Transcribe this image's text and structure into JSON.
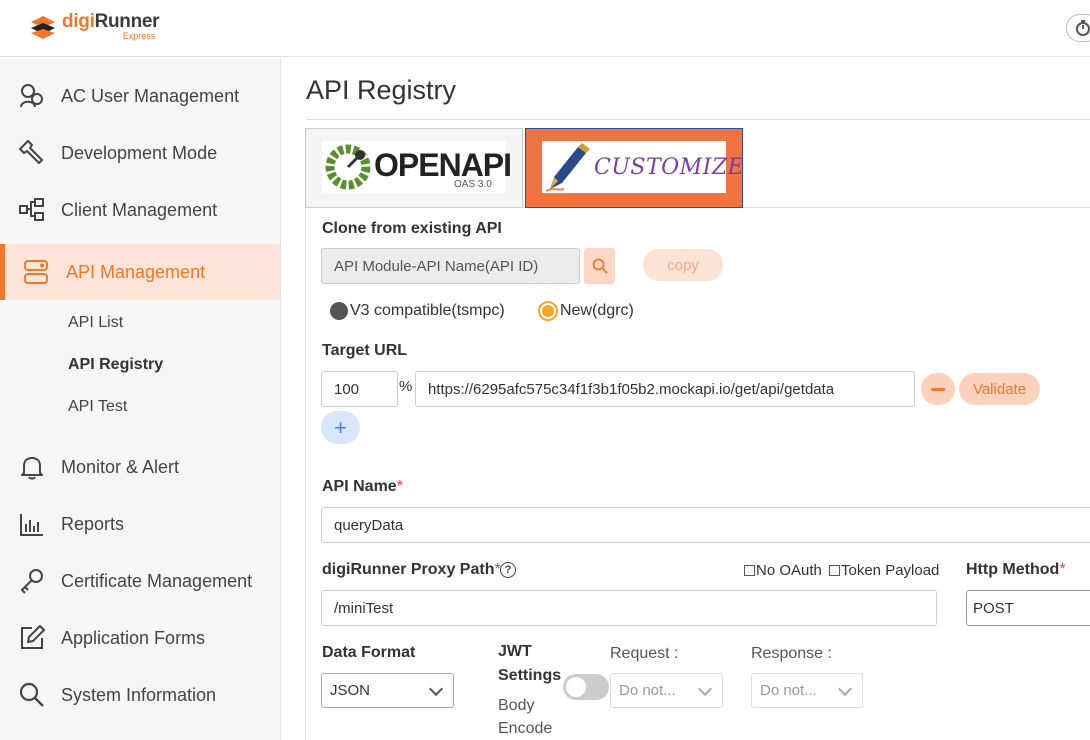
{
  "header": {
    "logo_brand_prefix": "digi",
    "logo_brand_suffix": "Runner",
    "logo_edition": "Express"
  },
  "sidebar": {
    "items": [
      {
        "label": "AC User Management",
        "icon": "users-icon"
      },
      {
        "label": "Development Mode",
        "icon": "wrench-icon"
      },
      {
        "label": "Client Management",
        "icon": "hierarchy-icon"
      },
      {
        "label": "API Management",
        "icon": "api-icon",
        "active": true
      },
      {
        "label": "Monitor & Alert",
        "icon": "bell-icon"
      },
      {
        "label": "Reports",
        "icon": "bar-chart-icon"
      },
      {
        "label": "Certificate Management",
        "icon": "key-icon"
      },
      {
        "label": "Application Forms",
        "icon": "edit-icon"
      },
      {
        "label": "System Information",
        "icon": "search-icon"
      }
    ],
    "sub_items": [
      {
        "label": "API List"
      },
      {
        "label": "API Registry",
        "active": true
      },
      {
        "label": "API Test"
      }
    ]
  },
  "page": {
    "title": "API Registry"
  },
  "tabs": [
    {
      "label": "OPENAPI",
      "sub": "OAS 3.0"
    },
    {
      "label": "CUSTOMIZE",
      "active": true
    }
  ],
  "form": {
    "clone_label": "Clone from existing API",
    "clone_placeholder": "API Module-API Name(API ID)",
    "copy_label": "copy",
    "radio_v3": "V3 compatible(tsmpc)",
    "radio_new": "New(dgrc)",
    "target_url_label": "Target URL",
    "target_pct": "100",
    "pct_sign": "%",
    "target_url": "https://6295afc575c34f1f3b1f05b2.mockapi.io/get/api/getdata",
    "validate_label": "Validate",
    "plus_label": "+",
    "api_name_label": "API Name",
    "required_mark": "*",
    "api_name_value": "queryData",
    "proxy_path_label": "digiRunner Proxy Path",
    "help_mark": "?",
    "no_oauth_label": "No OAuth",
    "token_payload_label": "Token Payload",
    "proxy_path_value": "/miniTest",
    "http_method_label": "Http Method",
    "http_method_value": "POST",
    "data_format_label": "Data Format",
    "data_format_value": "JSON",
    "jwt_label_1": "JWT",
    "jwt_label_2": "Settings",
    "request_label": "Request :",
    "request_value": "Do not...",
    "response_label": "Response :",
    "response_value": "Do not...",
    "body_encode_1": "Body",
    "body_encode_2": "Encode"
  },
  "colors": {
    "accent": "#f0772c",
    "active_bg": "#fde4d8",
    "customize_tab": "#f07342",
    "plus_blue": "#4a86e8"
  }
}
